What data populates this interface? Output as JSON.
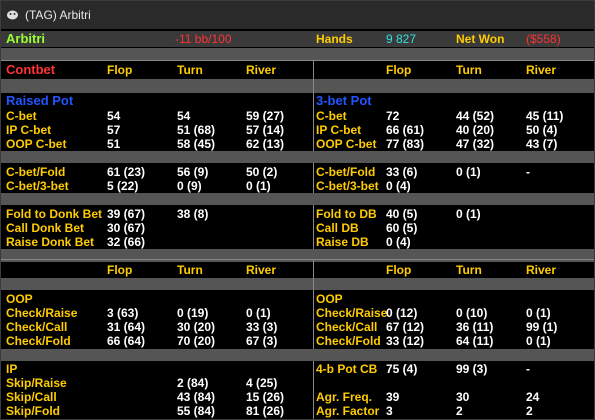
{
  "window": {
    "title": "(TAG) Arbitri"
  },
  "header": {
    "player": "Arbitri",
    "bb100": "-11 bb/100",
    "hands_label": "Hands",
    "hands_value": "9 827",
    "netwon_label": "Net Won",
    "netwon_value": "($558)"
  },
  "section1": {
    "title": "Contbet",
    "cols": [
      "Flop",
      "Turn",
      "River"
    ],
    "left_title": "Raised Pot",
    "right_title": "3-bet Pot",
    "left_rows": [
      [
        "C-bet",
        "54",
        "54",
        "59 (27)"
      ],
      [
        "IP C-bet",
        "57",
        "51 (68)",
        "57 (14)"
      ],
      [
        "OOP C-bet",
        "51",
        "58 (45)",
        "62 (13)"
      ],
      [
        "C-bet/Fold",
        "61 (23)",
        "56 (9)",
        "50 (2)"
      ],
      [
        "C-bet/3-bet",
        "5 (22)",
        "0 (9)",
        "0 (1)"
      ],
      [
        "Fold to Donk Bet",
        "39 (67)",
        "38 (8)",
        ""
      ],
      [
        "Call Donk Bet",
        "30 (67)",
        "",
        ""
      ],
      [
        "Raise Donk Bet",
        "32 (66)",
        "",
        ""
      ]
    ],
    "right_rows": [
      [
        "C-bet",
        "72",
        "44 (52)",
        "45 (11)"
      ],
      [
        "IP C-bet",
        "66 (61)",
        "40 (20)",
        "50 (4)"
      ],
      [
        "OOP C-bet",
        "77 (83)",
        "47 (32)",
        "43 (7)"
      ],
      [
        "C-bet/Fold",
        "33 (6)",
        "0 (1)",
        "-"
      ],
      [
        "C-bet/3-bet",
        "0 (4)",
        "",
        ""
      ],
      [
        "Fold to DB",
        "40 (5)",
        "0 (1)",
        ""
      ],
      [
        "Call DB",
        "60 (5)",
        "",
        ""
      ],
      [
        "Raise DB",
        "0 (4)",
        "",
        ""
      ]
    ]
  },
  "section2": {
    "cols": [
      "Flop",
      "Turn",
      "River"
    ],
    "left_oop_title": "OOP",
    "left_oop_rows": [
      [
        "Check/Raise",
        "3 (63)",
        "0 (19)",
        "0 (1)"
      ],
      [
        "Check/Call",
        "31 (64)",
        "30 (20)",
        "33 (3)"
      ],
      [
        "Check/Fold",
        "66 (64)",
        "70 (20)",
        "67 (3)"
      ]
    ],
    "left_ip_title": "IP",
    "left_ip_rows": [
      [
        "Skip/Raise",
        "",
        "2 (84)",
        "4 (25)"
      ],
      [
        "Skip/Call",
        "",
        "43 (84)",
        "15 (26)"
      ],
      [
        "Skip/Fold",
        "",
        "55 (84)",
        "81 (26)"
      ]
    ],
    "right_oop_title": "OOP",
    "right_oop_rows": [
      [
        "Check/Raise",
        "0 (12)",
        "0 (10)",
        "0 (1)"
      ],
      [
        "Check/Call",
        "67 (12)",
        "36 (11)",
        "99 (1)"
      ],
      [
        "Check/Fold",
        "33 (12)",
        "64 (11)",
        "0 (1)"
      ]
    ],
    "right_extra_rows": [
      [
        "4-b Pot CB",
        "75 (4)",
        "99 (3)",
        "-"
      ],
      [
        "Agr. Freq.",
        "39",
        "30",
        "24"
      ],
      [
        "Agr. Factor",
        "3",
        "2",
        "2"
      ]
    ]
  },
  "colors": {
    "label": "#ffcc00",
    "value": "#ffffff",
    "player": "#99ff33",
    "negative": "#ff3333",
    "hands": "#33e0e0",
    "subsection": "#2255ff"
  }
}
